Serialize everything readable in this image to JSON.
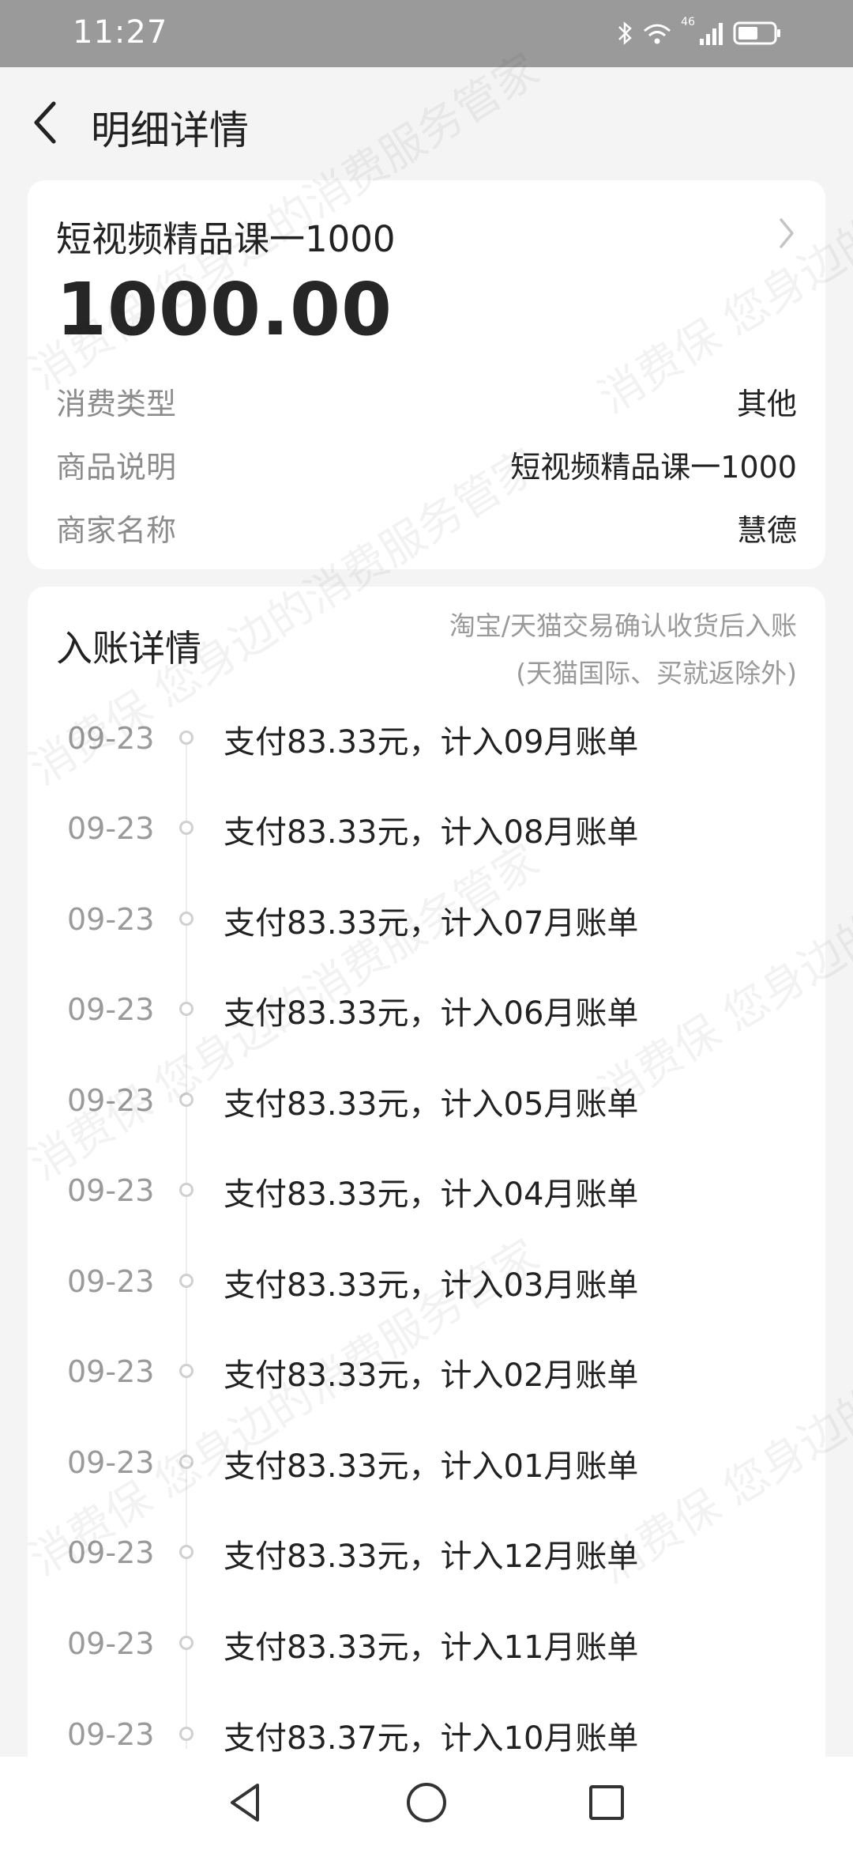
{
  "status_bar": {
    "time": "11:27",
    "network_label": "46",
    "icons": [
      "bluetooth-icon",
      "wifi-icon",
      "signal-icon",
      "battery-icon"
    ]
  },
  "header": {
    "title": "明细详情",
    "back_icon": "back-arrow-icon"
  },
  "summary": {
    "product_title": "短视频精品课一1000",
    "amount": "1000.00",
    "rows": [
      {
        "label": "消费类型",
        "value": "其他"
      },
      {
        "label": "商品说明",
        "value": "短视频精品课一1000"
      },
      {
        "label": "商家名称",
        "value": "慧德"
      }
    ]
  },
  "detail": {
    "title": "入账详情",
    "note_line1": "淘宝/天猫交易确认收货后入账",
    "note_line2": "(天猫国际、买就返除外)",
    "items": [
      {
        "date": "09-23",
        "text": "支付83.33元，计入09月账单"
      },
      {
        "date": "09-23",
        "text": "支付83.33元，计入08月账单"
      },
      {
        "date": "09-23",
        "text": "支付83.33元，计入07月账单"
      },
      {
        "date": "09-23",
        "text": "支付83.33元，计入06月账单"
      },
      {
        "date": "09-23",
        "text": "支付83.33元，计入05月账单"
      },
      {
        "date": "09-23",
        "text": "支付83.33元，计入04月账单"
      },
      {
        "date": "09-23",
        "text": "支付83.33元，计入03月账单"
      },
      {
        "date": "09-23",
        "text": "支付83.33元，计入02月账单"
      },
      {
        "date": "09-23",
        "text": "支付83.33元，计入01月账单"
      },
      {
        "date": "09-23",
        "text": "支付83.33元，计入12月账单"
      },
      {
        "date": "09-23",
        "text": "支付83.33元，计入11月账单"
      },
      {
        "date": "09-23",
        "text": "支付83.37元，计入10月账单"
      }
    ]
  },
  "watermark": {
    "text": "消费保 您身边的消费服务管家"
  },
  "nav_bar": {
    "buttons": [
      "nav-back-icon",
      "nav-home-icon",
      "nav-recent-icon"
    ]
  }
}
